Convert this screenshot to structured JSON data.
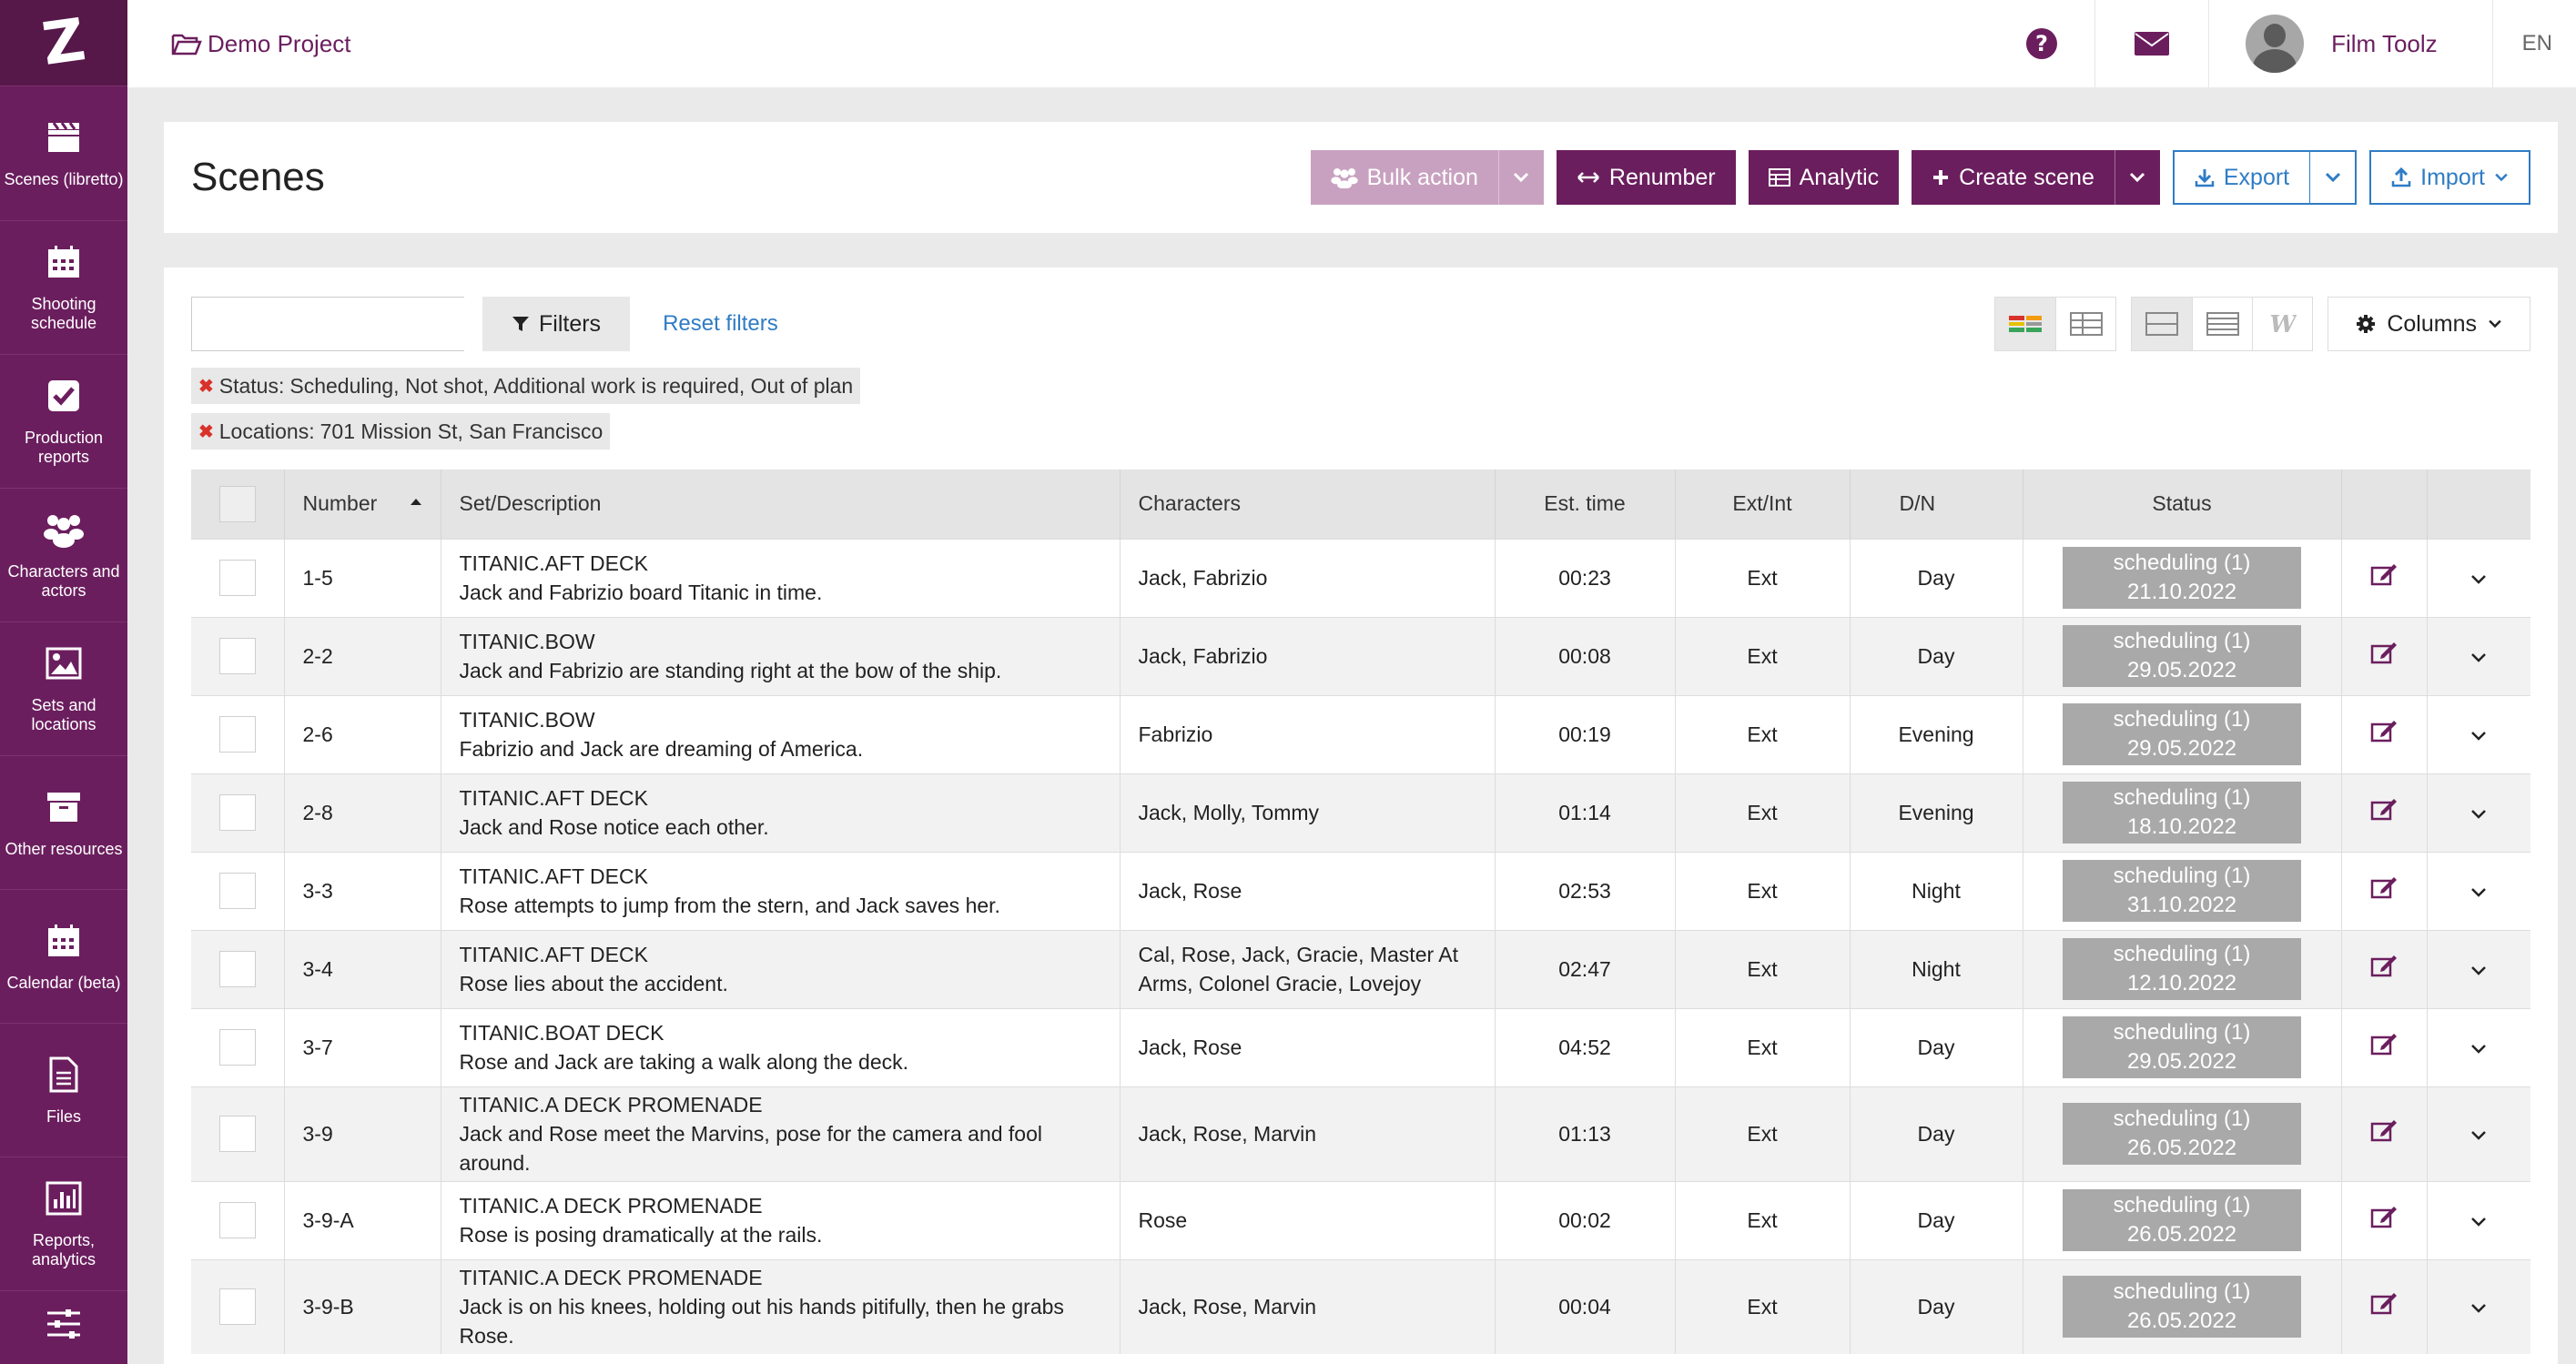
{
  "app": {
    "logo_letter": "Z"
  },
  "sidebar": {
    "items": [
      {
        "label": "Scenes (libretto)",
        "icon": "clapperboard-icon"
      },
      {
        "label": "Shooting schedule",
        "icon": "calendar-grid-icon"
      },
      {
        "label": "Production reports",
        "icon": "checkbox-icon"
      },
      {
        "label": "Characters and actors",
        "icon": "users-icon"
      },
      {
        "label": "Sets and locations",
        "icon": "image-icon"
      },
      {
        "label": "Other resources",
        "icon": "archive-box-icon"
      },
      {
        "label": "Calendar (beta)",
        "icon": "calendar-icon"
      },
      {
        "label": "Files",
        "icon": "file-icon"
      },
      {
        "label": "Reports, analytics",
        "icon": "bar-chart-icon"
      },
      {
        "label": "",
        "icon": "sliders-icon"
      }
    ]
  },
  "topbar": {
    "project": "Demo Project",
    "user_name": "Film Toolz",
    "language": "EN"
  },
  "header": {
    "title": "Scenes",
    "bulk_action": "Bulk action",
    "renumber": "Renumber",
    "analytic": "Analytic",
    "create_scene": "Create scene",
    "export": "Export",
    "import": "Import"
  },
  "toolbar": {
    "search_placeholder": "",
    "filters": "Filters",
    "reset_filters": "Reset filters",
    "columns": "Columns"
  },
  "active_filters": [
    {
      "label": "Status:",
      "value": "Scheduling, Not shot, Additional work is required, Out of plan"
    },
    {
      "label": "Locations:",
      "value": "701 Mission St, San Francisco"
    }
  ],
  "table": {
    "headers": {
      "number": "Number",
      "set": "Set/Description",
      "characters": "Characters",
      "est_time": "Est. time",
      "ext_int": "Ext/Int",
      "dn": "D/N",
      "status": "Status"
    },
    "rows": [
      {
        "number": "1-5",
        "set": "TITANIC.AFT DECK",
        "desc": "Jack and Fabrizio board Titanic in time.",
        "characters": "Jack, Fabrizio",
        "time": "00:23",
        "ext": "Ext",
        "dn": "Day",
        "status": "scheduling (1)",
        "date": "21.10.2022"
      },
      {
        "number": "2-2",
        "set": "TITANIC.BOW",
        "desc": "Jack and Fabrizio are standing right at the bow of the ship.",
        "characters": "Jack, Fabrizio",
        "time": "00:08",
        "ext": "Ext",
        "dn": "Day",
        "status": "scheduling (1)",
        "date": "29.05.2022"
      },
      {
        "number": "2-6",
        "set": "TITANIC.BOW",
        "desc": "Fabrizio and Jack are dreaming of America.",
        "characters": "Fabrizio",
        "time": "00:19",
        "ext": "Ext",
        "dn": "Evening",
        "status": "scheduling (1)",
        "date": "29.05.2022"
      },
      {
        "number": "2-8",
        "set": "TITANIC.AFT DECK",
        "desc": "Jack and Rose notice each other.",
        "characters": "Jack, Molly, Tommy",
        "time": "01:14",
        "ext": "Ext",
        "dn": "Evening",
        "status": "scheduling (1)",
        "date": "18.10.2022"
      },
      {
        "number": "3-3",
        "set": "TITANIC.AFT DECK",
        "desc": "Rose attempts to jump from the stern, and Jack saves her.",
        "characters": "Jack, Rose",
        "time": "02:53",
        "ext": "Ext",
        "dn": "Night",
        "status": "scheduling (1)",
        "date": "31.10.2022"
      },
      {
        "number": "3-4",
        "set": "TITANIC.AFT DECK",
        "desc": "Rose lies about the accident.",
        "characters": "Cal, Rose, Jack, Gracie, Master At Arms, Colonel Gracie, Lovejoy",
        "time": "02:47",
        "ext": "Ext",
        "dn": "Night",
        "status": "scheduling (1)",
        "date": "12.10.2022"
      },
      {
        "number": "3-7",
        "set": "TITANIC.BOAT DECK",
        "desc": "Rose and Jack are taking a walk along the deck.",
        "characters": "Jack, Rose",
        "time": "04:52",
        "ext": "Ext",
        "dn": "Day",
        "status": "scheduling (1)",
        "date": "29.05.2022"
      },
      {
        "number": "3-9",
        "set": "TITANIC.A DECK PROMENADE",
        "desc": "Jack and Rose meet the Marvins, pose for the camera and fool around.",
        "characters": "Jack, Rose, Marvin",
        "time": "01:13",
        "ext": "Ext",
        "dn": "Day",
        "status": "scheduling (1)",
        "date": "26.05.2022"
      },
      {
        "number": "3-9-A",
        "set": "TITANIC.A DECK PROMENADE",
        "desc": "Rose is posing dramatically at the rails.",
        "characters": "Rose",
        "time": "00:02",
        "ext": "Ext",
        "dn": "Day",
        "status": "scheduling (1)",
        "date": "26.05.2022"
      },
      {
        "number": "3-9-B",
        "set": "TITANIC.A DECK PROMENADE",
        "desc": "Jack is on his knees, holding out his hands pitifully, then he grabs Rose.",
        "characters": "Jack, Rose, Marvin",
        "time": "00:04",
        "ext": "Ext",
        "dn": "Day",
        "status": "scheduling (1)",
        "date": "26.05.2022"
      }
    ]
  },
  "colors": {
    "brand": "#6b1e5e",
    "link": "#2f7cc5",
    "status_badge": "#a9a9a9"
  }
}
